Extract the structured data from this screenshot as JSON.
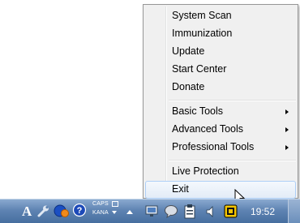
{
  "context_menu": {
    "items": [
      {
        "label": "System Scan"
      },
      {
        "label": "Immunization"
      },
      {
        "label": "Update"
      },
      {
        "label": "Start Center"
      },
      {
        "label": "Donate"
      },
      {
        "label": "Basic Tools",
        "submenu": true
      },
      {
        "label": "Advanced Tools",
        "submenu": true
      },
      {
        "label": "Professional Tools",
        "submenu": true
      },
      {
        "label": "Live Protection"
      },
      {
        "label": "Exit",
        "highlighted": true
      }
    ]
  },
  "taskbar": {
    "ime_mode_label": "A",
    "ime_caps_label": "CAPS",
    "ime_kana_label": "KANA",
    "clock": "19:52",
    "tray_icons": [
      "ime-mode-icon",
      "tools-icon",
      "ime-pad-icon",
      "help-icon",
      "caps-icon",
      "kana-icon",
      "show-hidden-icons",
      "network-icon",
      "action-center-icon",
      "clipboard-icon",
      "volume-icon",
      "spybot-tray-icon"
    ]
  },
  "colors": {
    "menu_background": "#f0f0f0",
    "menu_highlight": "#e3ecf7",
    "menu_highlight_border": "#aecff7",
    "taskbar_top": "#8aa9cf",
    "taskbar_bottom": "#466e9f"
  }
}
